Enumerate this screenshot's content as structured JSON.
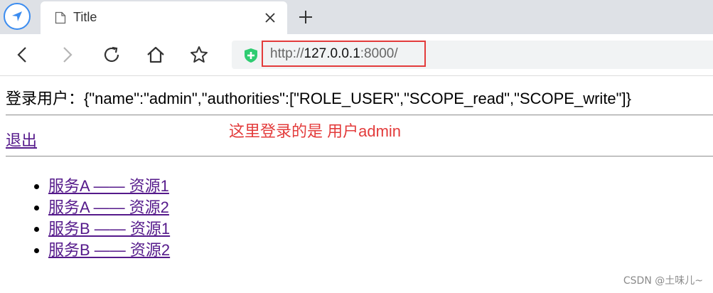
{
  "tab": {
    "title": "Title"
  },
  "address": {
    "url_scheme": "http://",
    "url_host": "127.0.0.1",
    "url_port": ":8000/"
  },
  "page": {
    "login_label": "登录用户：",
    "login_value": "{\"name\":\"admin\",\"authorities\":[\"ROLE_USER\",\"SCOPE_read\",\"SCOPE_write\"]}",
    "logout_label": "退出",
    "annotation": "这里登录的是 用户admin",
    "links": [
      {
        "label": "服务A —— 资源1"
      },
      {
        "label": "服务A —— 资源2"
      },
      {
        "label": "服务B —— 资源1"
      },
      {
        "label": "服务B —— 资源2"
      }
    ]
  },
  "watermark": "CSDN @土味儿~",
  "colors": {
    "annotation_red": "#e33b3b",
    "visited_link": "#551a8b",
    "browser_blue": "#3b8cf0",
    "shield_green": "#2ecc71"
  }
}
